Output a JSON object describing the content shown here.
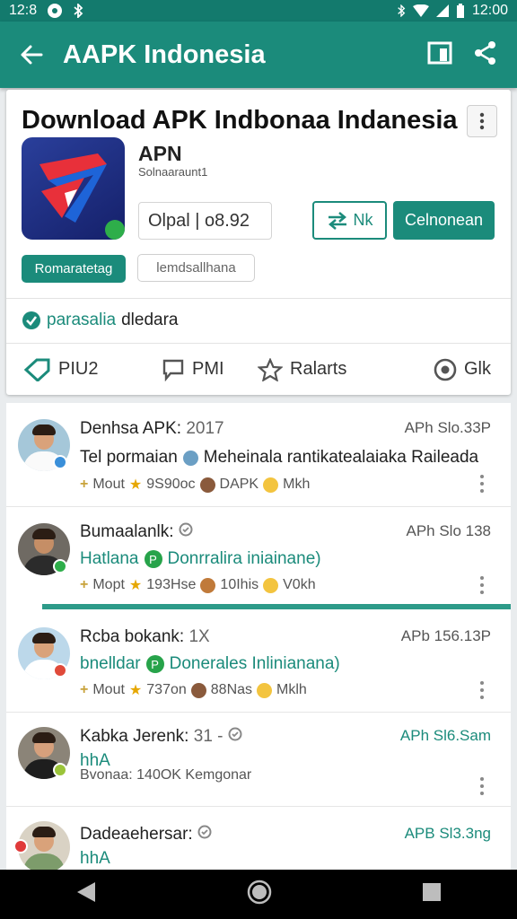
{
  "status_bar": {
    "time_left": "12:8",
    "time_right": "12:00"
  },
  "app_bar": {
    "title": "AAPK Indonesia"
  },
  "header_card": {
    "headline": "Download APK Indbonaa Indanesia",
    "app_name": "APN",
    "app_sub": "Solnaaraunt1",
    "version_text": "Olpal | o8.92",
    "outline_button_label": "Nk",
    "primary_button_label": "Celnonean",
    "chip_primary": "Romaratetag",
    "chip_secondary": "lemdsallhana",
    "verified_green": "parasalia",
    "verified_rest": "dledara",
    "tabs": [
      {
        "label": "PIU2",
        "icon": "tag-icon"
      },
      {
        "label": "PMI",
        "icon": "chat-icon"
      },
      {
        "label": "Ralarts",
        "icon": "star-icon"
      },
      {
        "label": "Glk",
        "icon": "settings-circle-icon"
      }
    ]
  },
  "list": [
    {
      "name": "Denhsa APK:",
      "name_extra": "2017",
      "right": "APh Slo.33P",
      "line2_pre": "Tel pormaian",
      "line2_post": "Meheinala rantikatealaiaka Raileada",
      "meta_a": "Mout",
      "meta_b": "9S90oc",
      "meta_c": "DAPK",
      "meta_d": "Mkh"
    },
    {
      "name": "Bumaalanlk:",
      "name_extra": "",
      "right": "APh Slo 138",
      "line2_pre": "Hatlana",
      "line2_post": "Donrralira iniainane)",
      "meta_a": "Mopt",
      "meta_b": "193Hse",
      "meta_c": "10Ihis",
      "meta_d": "V0kh"
    },
    {
      "name": "Rcba bokank:",
      "name_extra": "1X",
      "right": "APb 156.13P",
      "line2_pre": "bnelldar",
      "line2_post": "Donerales Inlinianana)",
      "meta_a": "Mout",
      "meta_b": "737on",
      "meta_c": "88Nas",
      "meta_d": "Mklh"
    },
    {
      "name": "Kabka Jerenk:",
      "name_extra": "31 -",
      "right": "APh Sl6.Sam",
      "line2_pre": "hhA",
      "line2_post": "",
      "meta_a": "Bvonaa: 140OK Kemgonar",
      "meta_b": "",
      "meta_c": "",
      "meta_d": ""
    },
    {
      "name": "Dadeaehersar:",
      "name_extra": "",
      "right": "APB Sl3.3ng",
      "line2_pre": "hhA",
      "line2_post": "",
      "meta_a": "",
      "meta_b": "",
      "meta_c": "",
      "meta_d": ""
    }
  ],
  "colors": {
    "primary": "#1b8b7b",
    "status_bar": "#137a6d",
    "accent_green": "#27a34a"
  }
}
